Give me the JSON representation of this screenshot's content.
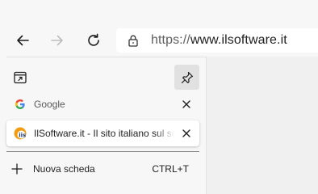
{
  "address_bar": {
    "url_scheme": "https://",
    "url_host": "www.ilsoftware.it"
  },
  "tabs": [
    {
      "title": "Google",
      "favicon": "google-g-icon",
      "active": false
    },
    {
      "title": "IlSoftware.it - Il sito italiano sul so",
      "favicon": "ilsoftware-favicon",
      "active": true
    }
  ],
  "new_tab": {
    "label": "Nuova scheda",
    "shortcut": "CTRL+T"
  },
  "icons": {
    "back": "arrow-left-icon",
    "forward": "arrow-right-icon",
    "refresh": "refresh-icon",
    "lock": "lock-icon",
    "tab_actions": "tab-actions-menu-icon",
    "pin": "pin-icon",
    "close": "close-icon",
    "plus": "plus-icon"
  },
  "colors": {
    "toolbar_bg": "#f7f7f7",
    "active_tab_bg": "#ffffff",
    "pin_button_bg": "#e1e1e1",
    "ilsoftware_orange": "#f39c12"
  }
}
